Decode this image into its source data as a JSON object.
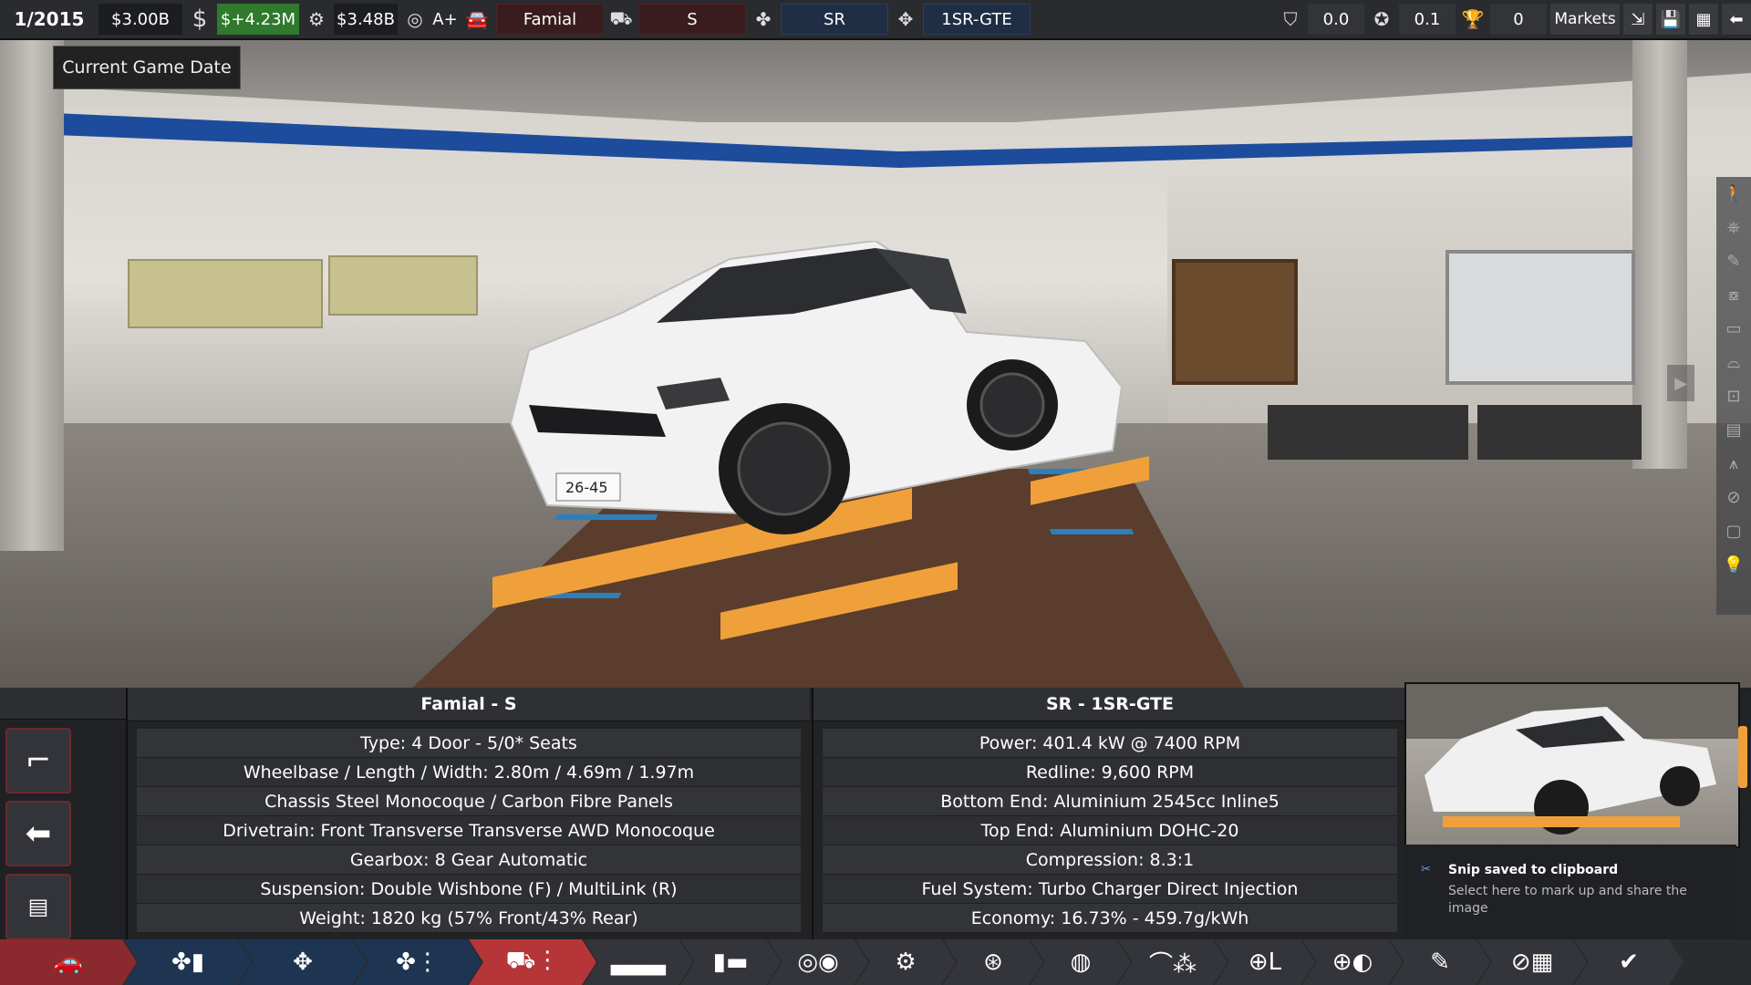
{
  "topbar": {
    "date": "1/2015",
    "money": "$3.00B",
    "dollar_icon": "$",
    "income": "$+4.23M",
    "loan": "$3.48B",
    "rating": "A+",
    "model": "Famial",
    "trim": "S",
    "engine_family": "SR",
    "engine_variant": "1SR-GTE",
    "stat_a": "0.0",
    "stat_b": "0.1",
    "trophies": "0",
    "markets_label": "Markets"
  },
  "tooltip": {
    "text": "Current Game Date"
  },
  "car_panel": {
    "title": "Famial - S",
    "rows": [
      "Type: 4 Door - 5/0* Seats",
      "Wheelbase / Length / Width: 2.80m / 4.69m / 1.97m",
      "Chassis Steel Monocoque / Carbon Fibre Panels",
      "Drivetrain: Front Transverse Transverse AWD Monocoque",
      "Gearbox: 8 Gear Automatic",
      "Suspension: Double Wishbone (F) / MultiLink (R)",
      "Weight: 1820 kg (57% Front/43% Rear)"
    ]
  },
  "engine_panel": {
    "title": "SR - 1SR-GTE",
    "rows": [
      "Power: 401.4 kW @ 7400 RPM",
      "Redline:  9,600 RPM",
      "Bottom End: Aluminium 2545cc Inline5",
      "Top End: Aluminium DOHC-20",
      "Compression: 8.3:1",
      "Fuel System: Turbo Charger Direct Injection",
      "Economy: 16.73% - 459.7g/kWh"
    ]
  },
  "toast": {
    "title": "Snip saved to clipboard",
    "body": "Select here to mark up and share the image"
  },
  "plate": "26-45",
  "colors": {
    "accent_red": "#b53539",
    "accent_blue": "#1e3552",
    "lift_orange": "#f0a03a",
    "income_green": "#2f7a2c"
  }
}
